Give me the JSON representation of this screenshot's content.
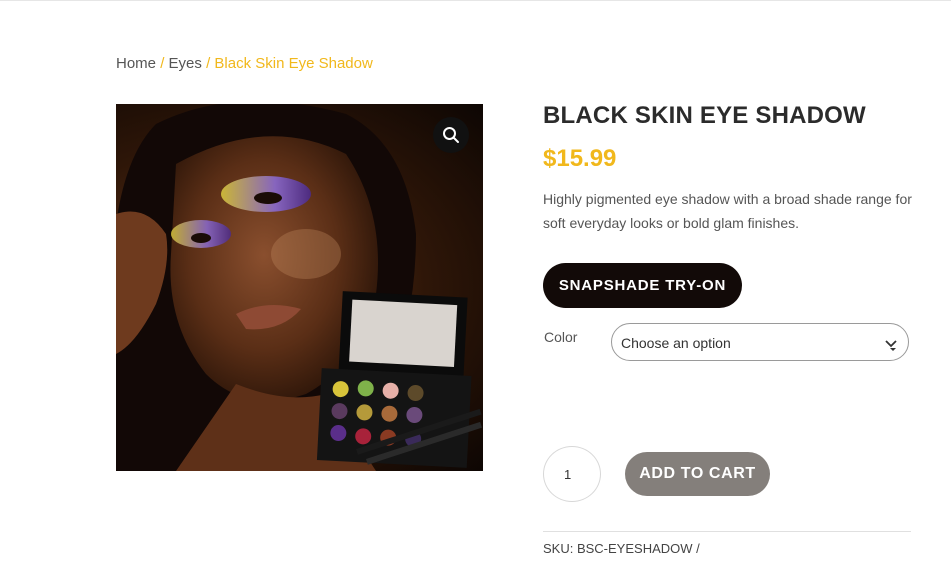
{
  "breadcrumb": {
    "home": "Home",
    "separator": "/",
    "category": "Eyes",
    "current": "Black Skin Eye Shadow"
  },
  "product": {
    "title": "BLACK SKIN EYE SHADOW",
    "price": "$15.99",
    "description": "Highly pigmented eye shadow with a broad shade range for soft everyday looks or bold glam finishes.",
    "image_icon": "zoom-magnifier-icon"
  },
  "actions": {
    "tryon_label": "SNAPSHADE TRY-ON",
    "color_label": "Color",
    "color_selected": "Choose an option",
    "quantity": "1",
    "add_to_cart_label": "ADD TO CART"
  },
  "meta": {
    "sku": "SKU: BSC-EYESHADOW /"
  },
  "colors": {
    "accent": "#f1b81c",
    "tryon_bg": "#120a08",
    "cart_bg": "#847f7b"
  }
}
